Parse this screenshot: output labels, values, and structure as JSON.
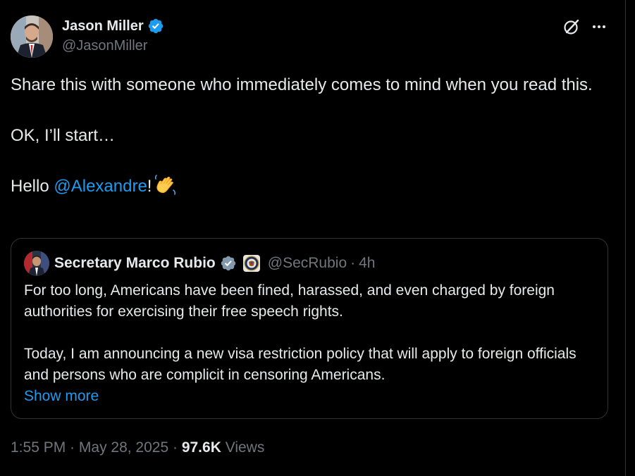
{
  "author": {
    "display_name": "Jason Miller",
    "handle": "@JasonMiller",
    "verified_icon": "verified-badge-icon"
  },
  "tweet": {
    "line1": "Share this with someone who immediately comes to mind when you read this.",
    "line2": "OK, I’ll start…",
    "line3_prefix": "Hello ",
    "line3_mention": "@Alexandre",
    "line3_suffix": "!",
    "emoji": "waving-hand-icon"
  },
  "quoted_tweet": {
    "display_name": "Secretary Marco Rubio",
    "handle": "@SecRubio",
    "separator": "·",
    "time": "4h",
    "paragraph1": "For too long, Americans have been fined, harassed, and even charged by foreign authorities for exercising their free speech rights.",
    "paragraph2": "Today, I am announcing a new visa restriction policy that will apply to foreign officials and persons who are complicit in censoring Americans.",
    "show_more": "Show more"
  },
  "meta": {
    "time": "1:55 PM",
    "sep1": " · ",
    "date": "May 28, 2025",
    "sep2": " · ",
    "views_count": "97.6K",
    "views_label": " Views"
  },
  "colors": {
    "background": "#000000",
    "text": "#e7e9ea",
    "secondary": "#71767b",
    "link": "#1d9bf0",
    "border": "#2f3336",
    "verified_blue": "#1d9bf0",
    "verified_gray": "#829aab"
  }
}
